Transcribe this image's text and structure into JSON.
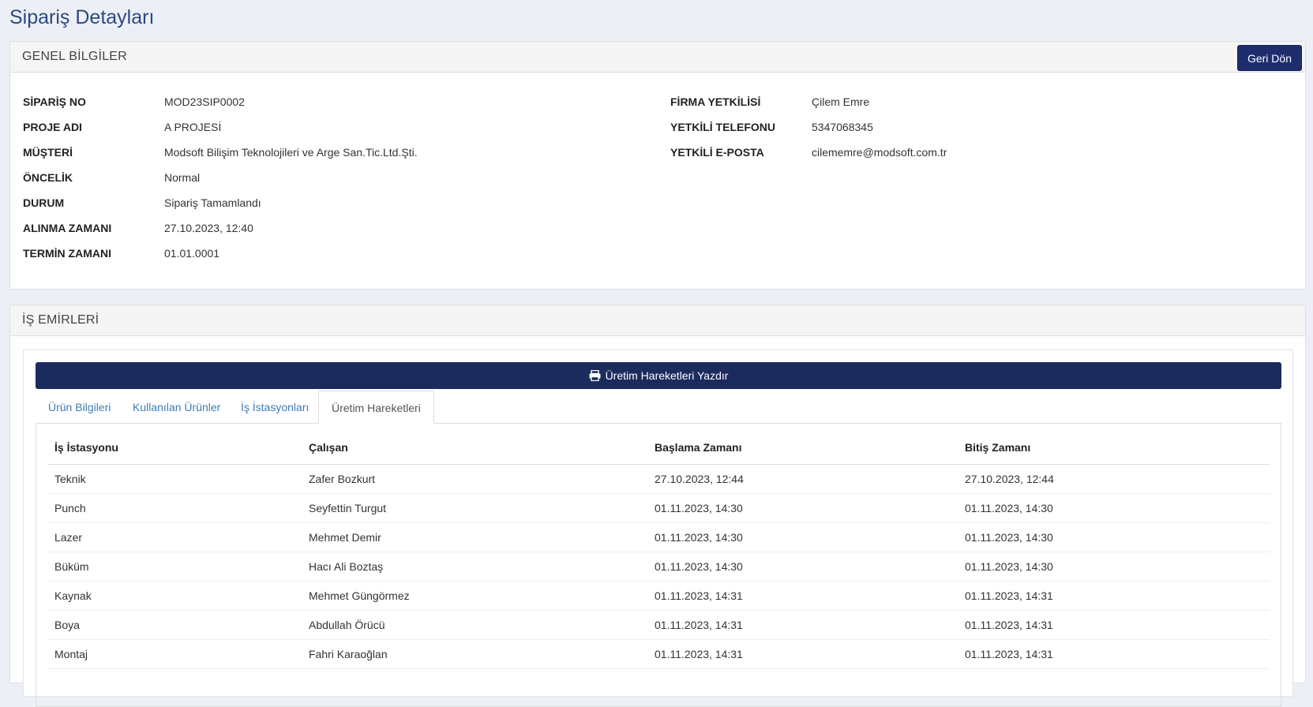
{
  "page_title": "Sipariş Detayları",
  "general": {
    "title": "GENEL BİLGİLER",
    "back_label": "Geri Dön",
    "left": [
      {
        "label": "SİPARİŞ NO",
        "value": "MOD23SIP0002"
      },
      {
        "label": "PROJE ADI",
        "value": "A PROJESİ"
      },
      {
        "label": "MÜŞTERİ",
        "value": "Modsoft Bilişim Teknolojileri ve Arge San.Tic.Ltd.Şti."
      },
      {
        "label": "ÖNCELİK",
        "value": "Normal"
      },
      {
        "label": "DURUM",
        "value": "Sipariş Tamamlandı"
      },
      {
        "label": "ALINMA ZAMANI",
        "value": "27.10.2023, 12:40"
      },
      {
        "label": "TERMİN ZAMANI",
        "value": "01.01.0001"
      }
    ],
    "right": [
      {
        "label": "FİRMA YETKİLİSİ",
        "value": "Çilem Emre"
      },
      {
        "label": "YETKİLİ TELEFONU",
        "value": "5347068345"
      },
      {
        "label": "YETKİLİ E-POSTA",
        "value": "cilememre@modsoft.com.tr"
      }
    ]
  },
  "work_orders": {
    "title": "İŞ EMİRLERİ",
    "print_label": "Üretim Hareketleri Yazdır",
    "tabs": [
      {
        "label": "Ürün Bilgileri"
      },
      {
        "label": "Kullanılan Ürünler"
      },
      {
        "label": "İş İstasyonları"
      },
      {
        "label": "Üretim Hareketleri"
      }
    ],
    "active_tab": "Üretim Hareketleri",
    "columns": [
      "İş İstasyonu",
      "Çalışan",
      "Başlama Zamanı",
      "Bitiş Zamanı"
    ],
    "rows": [
      [
        "Teknik",
        "Zafer Bozkurt",
        "27.10.2023, 12:44",
        "27.10.2023, 12:44"
      ],
      [
        "Punch",
        "Seyfettin Turgut",
        "01.11.2023, 14:30",
        "01.11.2023, 14:30"
      ],
      [
        "Lazer",
        "Mehmet Demir",
        "01.11.2023, 14:30",
        "01.11.2023, 14:30"
      ],
      [
        "Büküm",
        "Hacı Ali Boztaş",
        "01.11.2023, 14:30",
        "01.11.2023, 14:30"
      ],
      [
        "Kaynak",
        "Mehmet Güngörmez",
        "01.11.2023, 14:31",
        "01.11.2023, 14:31"
      ],
      [
        "Boya",
        "Abdullah Örücü",
        "01.11.2023, 14:31",
        "01.11.2023, 14:31"
      ],
      [
        "Montaj",
        "Fahri Karaoğlan",
        "01.11.2023, 14:31",
        "01.11.2023, 14:31"
      ]
    ]
  }
}
